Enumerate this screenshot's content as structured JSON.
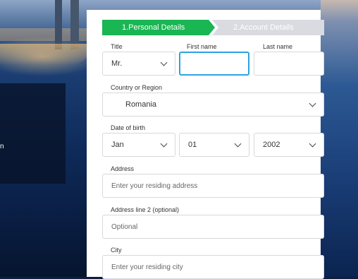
{
  "steps": {
    "step1_label": "1.Personal Details",
    "step2_label": "2.Account Details",
    "active_color": "#19b653",
    "inactive_color": "#d9dbe0"
  },
  "form": {
    "title_label": "Title",
    "title_value": "Mr.",
    "first_name_label": "First name",
    "first_name_value": "",
    "last_name_label": "Last name",
    "last_name_value": "",
    "country_label": "Country or Region",
    "country_value": "Romania",
    "dob_label": "Date of birth",
    "dob_month": "Jan",
    "dob_day": "01",
    "dob_year": "2002",
    "address_label": "Address",
    "address_placeholder": "Enter your residing address",
    "address2_label": "Address line 2 (optional)",
    "address2_placeholder": "Optional",
    "city_label": "City",
    "city_placeholder": "Enter your residing city",
    "focus_color": "#2da3e0"
  },
  "background": {
    "side_text": "n"
  },
  "icons": {
    "dropdown": "chevron-down-icon"
  }
}
